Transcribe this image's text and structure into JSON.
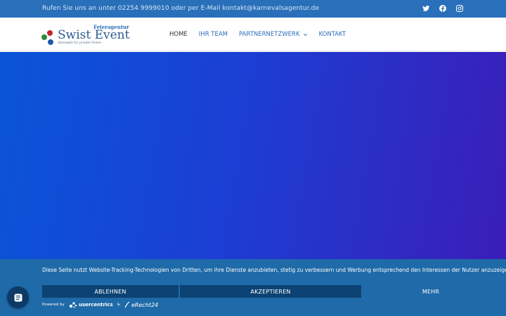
{
  "topbar": {
    "contact_text": "Rufen Sie uns an unter 02254 9999010 oder per E-Mail kontakt@karnevalsagentur.de",
    "social": [
      "twitter-icon",
      "facebook-icon",
      "instagram-icon"
    ]
  },
  "logo": {
    "small_top": "Feieragentur",
    "name": "Swist Event",
    "tagline": "Konzepte für private Feiern"
  },
  "nav": {
    "items": [
      {
        "label": "HOME"
      },
      {
        "label": "IHR TEAM"
      },
      {
        "label": "PARTNERNETZWERK"
      },
      {
        "label": "KONTAKT"
      }
    ]
  },
  "consent": {
    "message": "Diese Seite nutzt Website-Tracking-Technologien von Dritten, um ihre Dienste anzubieten, stetig zu verbessern und Werbung entsprechend den Interessen der Nutzer anzuzeigen.",
    "decline_label": "ABLEHNEN",
    "accept_label": "AKZEPTIEREN",
    "more_label": "MEHR",
    "powered_by": "Powered by",
    "brand1": "usercentrics",
    "amp": "&",
    "brand2": "eRecht24"
  },
  "colors": {
    "topbar": "#2a6fb9",
    "consent_bg": "#1f6aa8",
    "button_dark": "#0d4274",
    "hero_start": "#0a55d8",
    "hero_end": "#3b1db8"
  }
}
